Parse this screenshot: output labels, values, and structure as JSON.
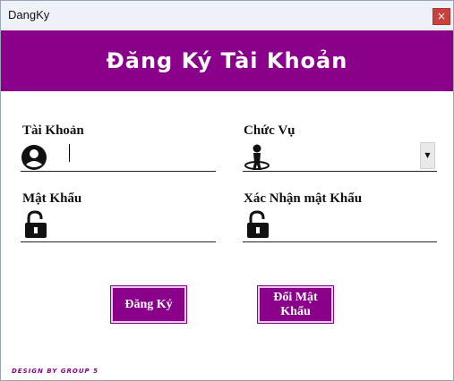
{
  "window": {
    "title": "DangKy",
    "close_symbol": "×"
  },
  "banner": {
    "title": "Đăng Ký Tài Khoản"
  },
  "form": {
    "account_label": "Tài Khoản",
    "account_value": "",
    "role_label": "Chức Vụ",
    "role_value": "",
    "password_label": "Mật Khẩu",
    "password_value": "",
    "confirm_label": "Xác Nhận mật Khẩu",
    "confirm_value": ""
  },
  "buttons": {
    "register": "Đăng Ký",
    "change_password": "Đổi Mật Khẩu"
  },
  "footer": {
    "text": "DESIGN BY GROUP 5"
  },
  "colors": {
    "accent": "#8b008b",
    "close": "#c9403d"
  },
  "icons": [
    "user-icon",
    "role-icon",
    "dropdown-arrow-icon",
    "unlock-icon"
  ]
}
